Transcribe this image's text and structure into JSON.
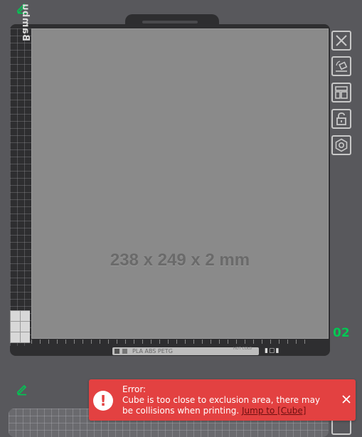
{
  "plate": {
    "brand_label": "Bambu Textured PEI Plate",
    "dimensions": "238 x 249 x 2 mm",
    "label_strip_text": "PLA ABS PETG",
    "label_strip_small": "HOT COLD",
    "number": "02"
  },
  "toolbar": {
    "buttons": [
      "close-icon",
      "auto-orient-icon",
      "arrange-icon",
      "lock-icon",
      "settings-icon"
    ]
  },
  "error_toast": {
    "title": "Error:",
    "message": "Cube is too close to exclusion area, there may be collisions when printing.",
    "link": "Jump to [Cube]"
  },
  "colors": {
    "background": "#58585c",
    "bed": "#8a8a8a",
    "plate_number": "#00c853",
    "edit_icon": "#00c853",
    "error": "#e34141"
  }
}
